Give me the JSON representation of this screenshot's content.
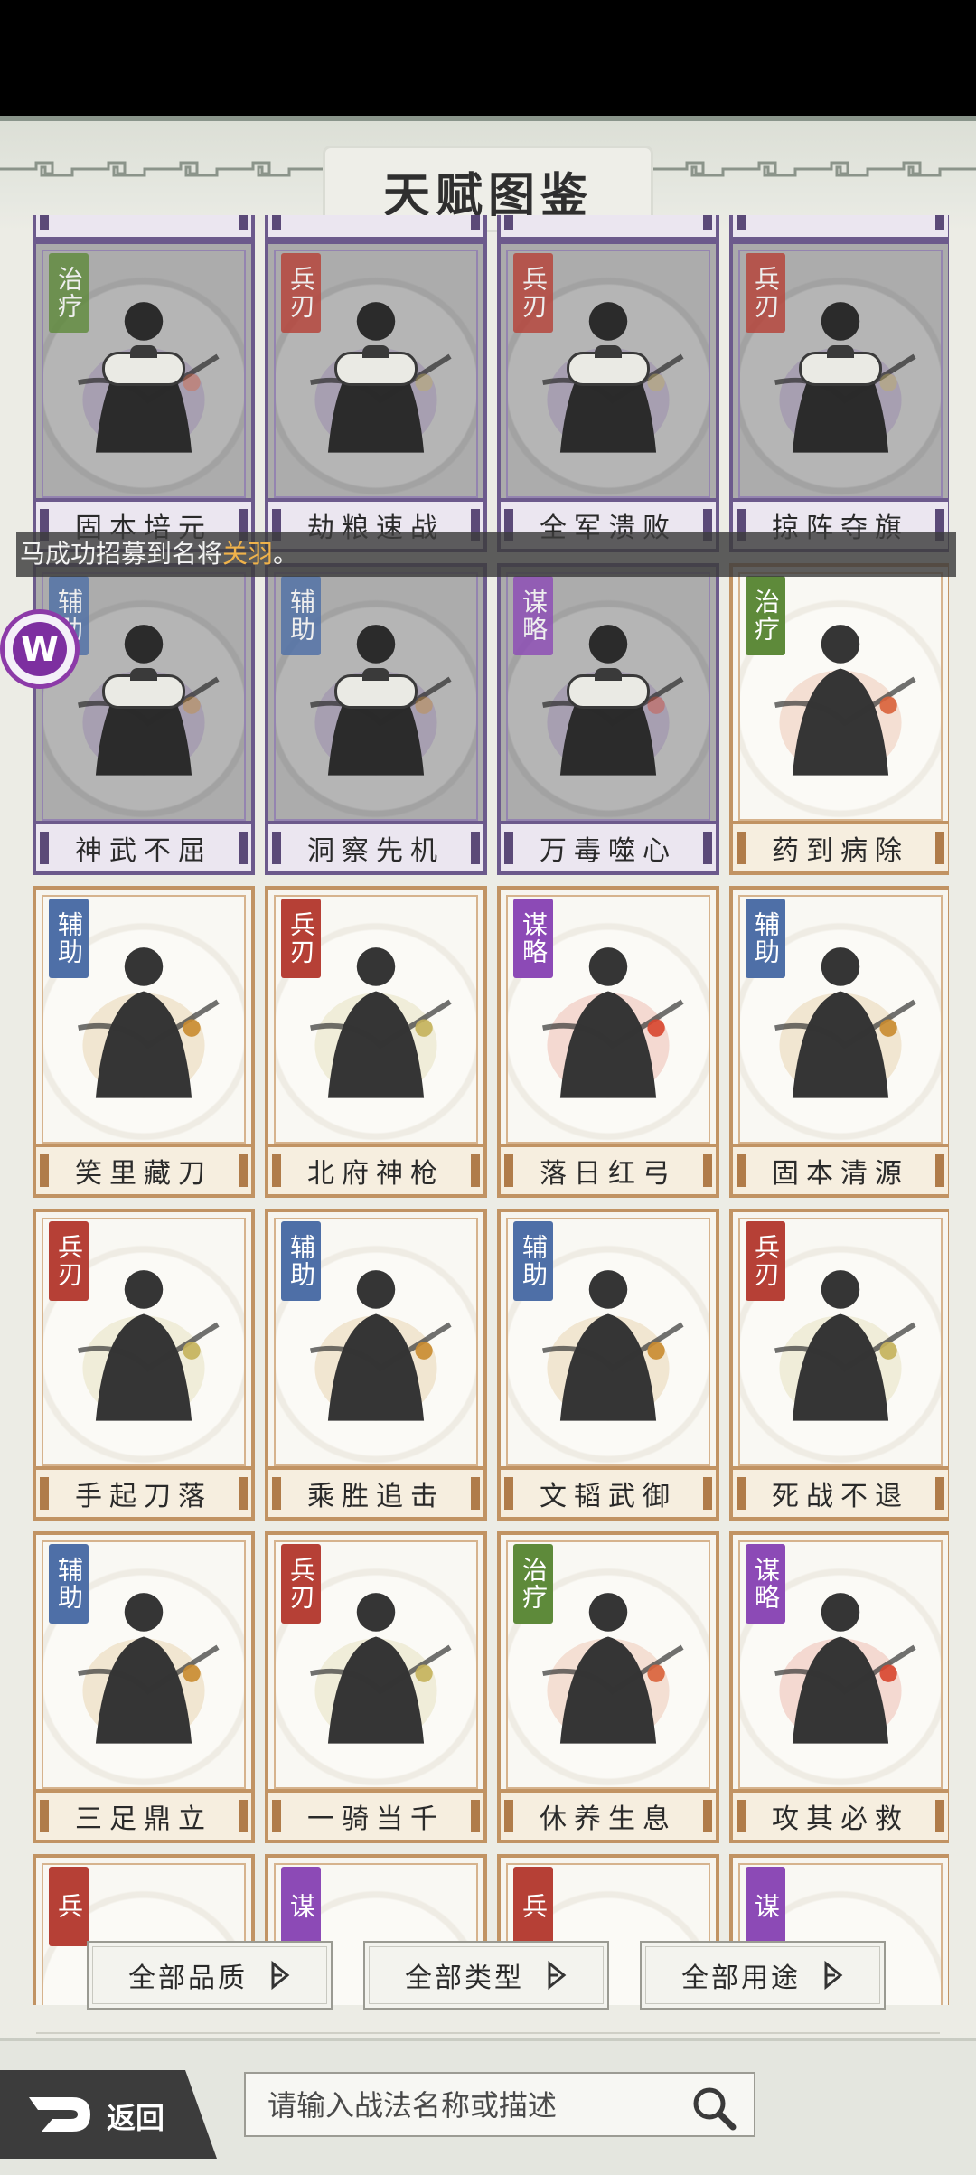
{
  "header": {
    "title": "天赋图鉴"
  },
  "toast": {
    "prefix": "马成功招募到名将",
    "highlight": "关羽",
    "suffix": "。"
  },
  "cards": [
    {
      "name": "固本培元",
      "type": "治疗",
      "type_key": "zhiliao",
      "locked": true
    },
    {
      "name": "劫粮速战",
      "type": "兵刃",
      "type_key": "bingren",
      "locked": true
    },
    {
      "name": "全军溃败",
      "type": "兵刃",
      "type_key": "bingren",
      "locked": true
    },
    {
      "name": "掠阵夺旗",
      "type": "兵刃",
      "type_key": "bingren",
      "locked": true
    },
    {
      "name": "神武不屈",
      "type": "辅助",
      "type_key": "fuzhu",
      "locked": true
    },
    {
      "name": "洞察先机",
      "type": "辅助",
      "type_key": "fuzhu",
      "locked": true
    },
    {
      "name": "万毒噬心",
      "type": "谋略",
      "type_key": "moulue",
      "locked": true
    },
    {
      "name": "药到病除",
      "type": "治疗",
      "type_key": "zhiliao",
      "locked": false
    },
    {
      "name": "笑里藏刀",
      "type": "辅助",
      "type_key": "fuzhu",
      "locked": false
    },
    {
      "name": "北府神枪",
      "type": "兵刃",
      "type_key": "bingren",
      "locked": false
    },
    {
      "name": "落日红弓",
      "type": "谋略",
      "type_key": "moulue",
      "locked": false
    },
    {
      "name": "固本清源",
      "type": "辅助",
      "type_key": "fuzhu",
      "locked": false
    },
    {
      "name": "手起刀落",
      "type": "兵刃",
      "type_key": "bingren",
      "locked": false
    },
    {
      "name": "乘胜追击",
      "type": "辅助",
      "type_key": "fuzhu",
      "locked": false
    },
    {
      "name": "文韬武御",
      "type": "辅助",
      "type_key": "fuzhu",
      "locked": false
    },
    {
      "name": "死战不退",
      "type": "兵刃",
      "type_key": "bingren",
      "locked": false
    },
    {
      "name": "三足鼎立",
      "type": "辅助",
      "type_key": "fuzhu",
      "locked": false
    },
    {
      "name": "一骑当千",
      "type": "兵刃",
      "type_key": "bingren",
      "locked": false
    },
    {
      "name": "休养生息",
      "type": "治疗",
      "type_key": "zhiliao",
      "locked": false
    },
    {
      "name": "攻其必救",
      "type": "谋略",
      "type_key": "moulue",
      "locked": false
    }
  ],
  "partial_top_row": [
    "",
    "",
    "",
    ""
  ],
  "partial_bottom_row": [
    {
      "type": "兵",
      "type_key": "bingren"
    },
    {
      "type": "谋",
      "type_key": "moulue"
    },
    {
      "type": "兵",
      "type_key": "bingren"
    },
    {
      "type": "谋",
      "type_key": "moulue"
    }
  ],
  "filters": {
    "quality_label": "全部品质",
    "type_label": "全部类型",
    "usage_label": "全部用途"
  },
  "footer": {
    "back_label": "返回",
    "search_placeholder": "请输入战法名称或描述"
  },
  "floating_logo": {
    "letter": "W"
  },
  "colors": {
    "zhiliao": "#5e8a3a",
    "bingren": "#b64036",
    "fuzhu": "#4e6fa7",
    "moulue": "#8c4ab6",
    "frame_gold": "#c19363",
    "frame_locked": "#6c5a8c"
  }
}
